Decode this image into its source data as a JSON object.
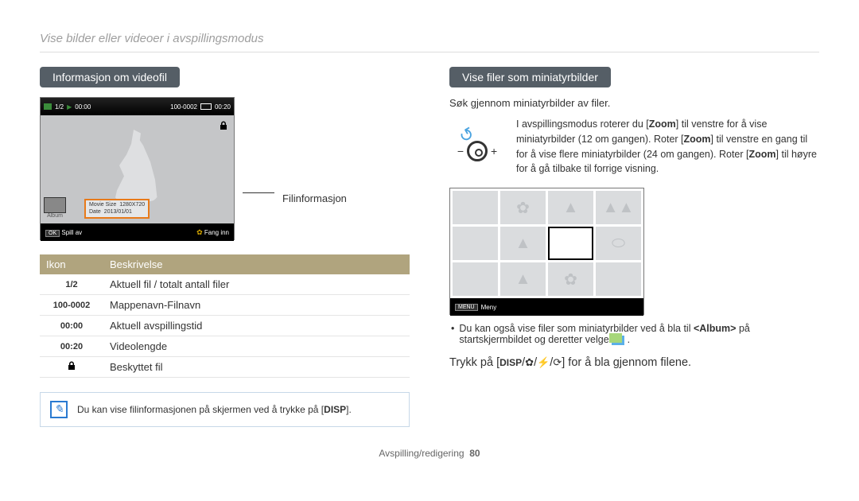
{
  "page": {
    "title": "Vise bilder eller videoer i avspillingsmodus",
    "footer_section": "Avspilling/redigering",
    "footer_page": "80"
  },
  "left": {
    "heading": "Informasjon om videofil",
    "screen": {
      "counter": "1/2",
      "playtime": "00:00",
      "folderfile": "100-0002",
      "duration": "00:20",
      "info_movie_size_label": "Movie Size",
      "info_movie_size_value": "1280X720",
      "info_date_label": "Date",
      "info_date_value": "2013/01/01",
      "album_label": "Album",
      "ok_label": "OK",
      "play_label": "Spill av",
      "capture_label": "Fang inn"
    },
    "fileinfo_label": "Filinformasjon",
    "table": {
      "head_icon": "Ikon",
      "head_desc": "Beskrivelse",
      "rows": [
        {
          "icon": "1/2",
          "desc": "Aktuell fil / totalt antall filer"
        },
        {
          "icon": "100-0002",
          "desc": "Mappenavn-Filnavn"
        },
        {
          "icon": "00:00",
          "desc": "Aktuell avspillingstid"
        },
        {
          "icon": "00:20",
          "desc": "Videolengde"
        },
        {
          "icon": "lock",
          "desc": "Beskyttet fil"
        }
      ]
    },
    "note": "Du kan vise filinformasjonen på skjermen ved å trykke på [DISP]."
  },
  "right": {
    "heading": "Vise filer som miniatyrbilder",
    "intro": "Søk gjennom miniatyrbilder av filer.",
    "zoom_minus": "−",
    "zoom_plus": "+",
    "zoom_text_1": "I avspillingsmodus roterer du [",
    "zoom_bold_1": "Zoom",
    "zoom_text_2": "] til venstre for å vise miniatyrbilder (12 om gangen). Roter [",
    "zoom_bold_2": "Zoom",
    "zoom_text_3": "] til venstre en gang til for å vise flere miniatyrbilder (24 om gangen). Roter [",
    "zoom_bold_3": "Zoom",
    "zoom_text_4": "] til høyre for å gå tilbake til forrige visning.",
    "thumb_menu_btn": "MENU",
    "thumb_menu_label": "Meny",
    "bullet_1a": "Du kan også vise filer som miniatyrbilder ved å bla til ",
    "bullet_1b": "<Album>",
    "bullet_1c": " på startskjermbildet og deretter velge ",
    "instruction_pre": "Trykk på [",
    "instruction_disp": "DISP",
    "instruction_post": "] for å bla gjennom filene."
  }
}
